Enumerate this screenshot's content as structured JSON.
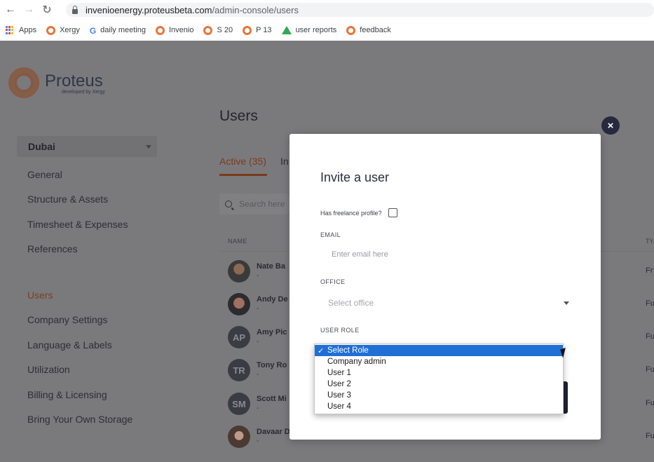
{
  "browser": {
    "url_host": "invenioenergy.proteusbeta.com",
    "url_path": "/admin-console/users",
    "bookmarks": [
      "Apps",
      "Xergy",
      "daily meeting",
      "Invenio",
      "S 20",
      "P 13",
      "user reports",
      "feedback"
    ]
  },
  "logo": {
    "name": "Proteus",
    "sub": "developed by Xergy"
  },
  "sidebar": {
    "office": "Dubai",
    "items": [
      "General",
      "Structure & Assets",
      "Timesheet & Expenses",
      "References",
      "Users",
      "Company Settings",
      "Language & Labels",
      "Utilization",
      "Billing & Licensing",
      "Bring Your Own Storage"
    ],
    "active": "Users"
  },
  "main": {
    "title": "Users",
    "tab_active": "Active (35)",
    "tab_other": "In",
    "search_placeholder": "Search here",
    "col_name": "NAME",
    "col_type": "TY",
    "users": [
      {
        "name": "Nate Ba",
        "sub": "-",
        "initials": "",
        "type": "Fr"
      },
      {
        "name": "Andy De",
        "sub": "-",
        "initials": "",
        "type": "Fu"
      },
      {
        "name": "Amy Pic",
        "sub": "-",
        "initials": "AP",
        "type": "Fu"
      },
      {
        "name": "Tony Ro",
        "sub": "-",
        "initials": "TR",
        "type": "Fu"
      },
      {
        "name": "Scott Mi",
        "sub": "-",
        "initials": "SM",
        "type": "Fu"
      },
      {
        "name": "Davaar D",
        "sub": "-",
        "initials": "",
        "type": "Fu"
      }
    ]
  },
  "modal": {
    "title": "Invite a user",
    "freelance_label": "Has freelance profile?",
    "email_label": "EMAIL",
    "email_placeholder": "Enter email here",
    "office_label": "OFFICE",
    "office_placeholder": "Select office",
    "role_label": "USER ROLE",
    "role_options": [
      "Select Role",
      "Company admin",
      "User 1",
      "User 2",
      "User 3",
      "User 4"
    ],
    "selected_role": "Select Role",
    "selected_marker": "✓",
    "close_glyph": "×"
  }
}
